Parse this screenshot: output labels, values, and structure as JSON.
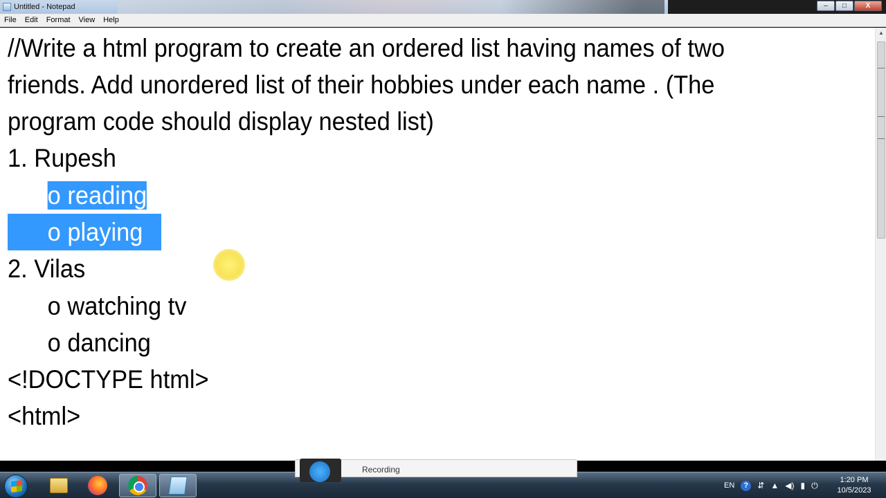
{
  "window": {
    "title": "Untitled - Notepad",
    "controls": {
      "minimize": "–",
      "maximize": "□",
      "close": "X"
    }
  },
  "menu": {
    "file": "File",
    "edit": "Edit",
    "format": "Format",
    "view": "View",
    "help": "Help"
  },
  "editor": {
    "lines": [
      "//Write a html program to create an ordered list having names of two",
      "friends. Add unordered list of their hobbies under each name . (The",
      "program code should display nested list)",
      "1. Rupesh",
      "o reading",
      "o playing",
      "2. Vilas",
      "o watching tv",
      "o dancing",
      "<!DOCTYPE html>",
      "<html>"
    ]
  },
  "recorder": {
    "label": "Recording"
  },
  "taskbar": {
    "apps": [
      "windows-explorer",
      "firefox",
      "chrome",
      "notepad"
    ],
    "language": "EN",
    "help": "?",
    "time": "1:20 PM",
    "date": "10/5/2023"
  },
  "colors": {
    "selection": "#3399ff",
    "cursor_highlight": "#f8e35a",
    "taskbar": "#1a2938"
  }
}
